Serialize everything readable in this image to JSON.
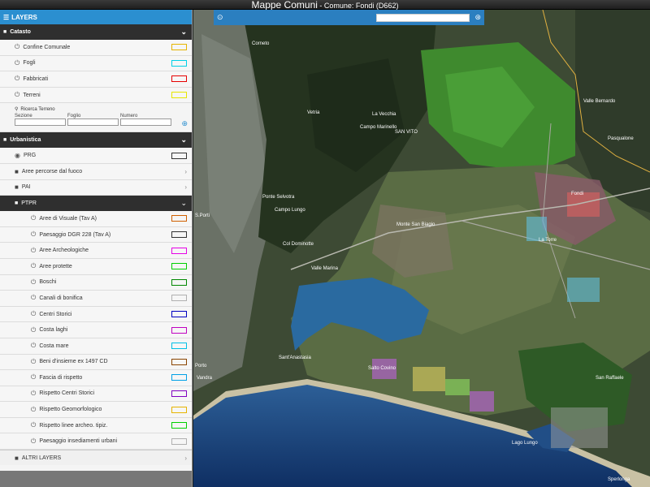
{
  "titlebar": {
    "app": "Mappe Comuni",
    "sub": " - Comune: Fondi (D662)"
  },
  "sidebar": {
    "header": "LAYERS",
    "catasto": {
      "label": "Catasto",
      "items": [
        {
          "label": "Confine Comunale",
          "color": "#e6b400"
        },
        {
          "label": "Fogli",
          "color": "#00d0e6"
        },
        {
          "label": "Fabbricati",
          "color": "#e60000"
        },
        {
          "label": "Terreni",
          "color": "#e6e600"
        }
      ],
      "search": {
        "title": "Ricerca Terreno",
        "fields": [
          "Sezione",
          "Foglio",
          "Numero"
        ]
      }
    },
    "urbanistica": {
      "label": "Urbanistica",
      "prg": {
        "label": "PRG",
        "color": "#333333"
      },
      "folders": [
        "Aree percorse dal fuoco",
        "PAI"
      ],
      "ptpr": {
        "label": "PTPR",
        "items": [
          {
            "label": "Aree di Visuale (Tav A)",
            "color": "#d06000"
          },
          {
            "label": "Paesaggio DGR 228 (Tav A)",
            "color": "#333333"
          },
          {
            "label": "Aree Archeologiche",
            "color": "#e600e6"
          },
          {
            "label": "Aree protette",
            "color": "#00d000"
          },
          {
            "label": "Boschi",
            "color": "#008800"
          },
          {
            "label": "Canali di bonifica",
            "color": "#b0b0b0"
          },
          {
            "label": "Centri Storici",
            "color": "#0000c0"
          },
          {
            "label": "Costa laghi",
            "color": "#c000c0"
          },
          {
            "label": "Costa mare",
            "color": "#00c0e6"
          },
          {
            "label": "Beni d'insieme ex 1497 CD",
            "color": "#8a4500"
          },
          {
            "label": "Fascia di rispetto",
            "color": "#00a0e6"
          },
          {
            "label": "Rispetto Centri Storici",
            "color": "#8000c0"
          },
          {
            "label": "Rispetto Geomorfologico",
            "color": "#e6b400"
          },
          {
            "label": "Rispetto linee archeo. tipiz.",
            "color": "#00d000"
          },
          {
            "label": "Paesaggio insediamenti urbani",
            "color": "#b0b0b0"
          }
        ]
      }
    },
    "altri": "ALTRI LAYERS"
  },
  "map": {
    "labels": [
      "Vetria",
      "La Vecchia",
      "Campo Marinello",
      "SAN VITO",
      "Valle Bernardo",
      "Pasqualone",
      "Ponte Selvotra",
      "Campo Lungo",
      "Monte San Biagio",
      "Col Dominotte",
      "Valle Marina",
      "Fondi",
      "Sant'Anastasia",
      "Salto Covino",
      "San Raffaele",
      "Lago Lungo",
      "Sperlonga",
      "Corneto",
      "Porto",
      "Vandra",
      "S.Porti",
      "SAN VITO",
      "La Torre"
    ]
  }
}
